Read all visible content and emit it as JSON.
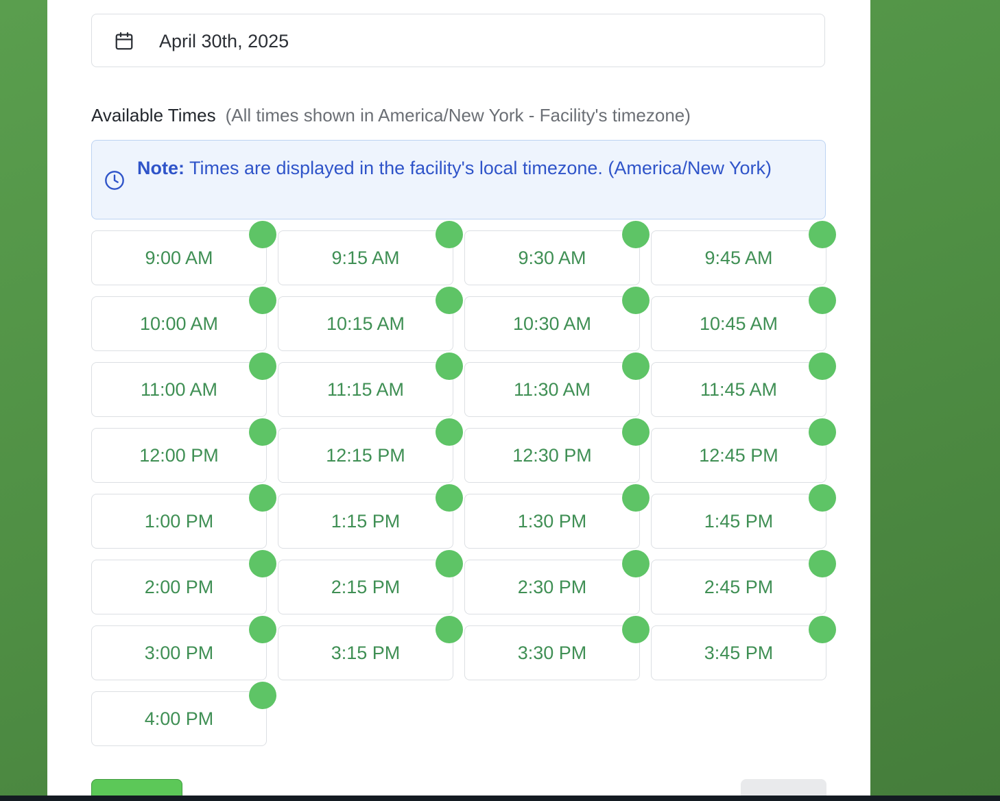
{
  "date_picker": {
    "value": "April 30th, 2025",
    "icon": "calendar-icon"
  },
  "available_times": {
    "title": "Available Times",
    "subtitle": "(All times shown in America/New York - Facility's timezone)"
  },
  "note": {
    "icon": "clock-icon",
    "label": "Note:",
    "text": "Times are displayed in the facility's local timezone. (America/New York)"
  },
  "time_slots": [
    "9:00 AM",
    "9:15 AM",
    "9:30 AM",
    "9:45 AM",
    "10:00 AM",
    "10:15 AM",
    "10:30 AM",
    "10:45 AM",
    "11:00 AM",
    "11:15 AM",
    "11:30 AM",
    "11:45 AM",
    "12:00 PM",
    "12:15 PM",
    "12:30 PM",
    "12:45 PM",
    "1:00 PM",
    "1:15 PM",
    "1:30 PM",
    "1:45 PM",
    "2:00 PM",
    "2:15 PM",
    "2:30 PM",
    "2:45 PM",
    "3:00 PM",
    "3:15 PM",
    "3:30 PM",
    "3:45 PM",
    "4:00 PM"
  ],
  "colors": {
    "background": "#4f8f44",
    "slot_text": "#3f8f54",
    "availability_dot": "#5ec466",
    "note_text": "#2f54c9",
    "note_bg": "#eef4fd"
  }
}
